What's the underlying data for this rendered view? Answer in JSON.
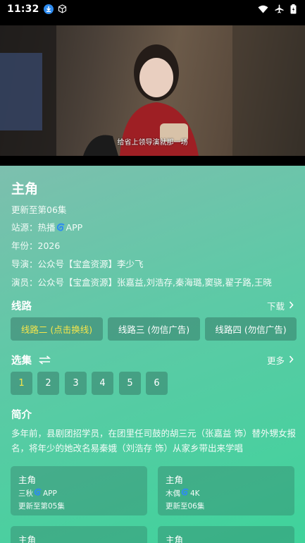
{
  "status_bar": {
    "time": "11:32"
  },
  "video": {
    "subtitle": "给省上领导演就那一场"
  },
  "detail": {
    "title": "主角",
    "update_status": "更新至第06集",
    "site_label": "站源：",
    "site_name": "热播",
    "site_suffix": "APP",
    "year": "年份：2026",
    "director": "导演：公众号【宝盒资源】李少飞",
    "cast": "演员：公众号【宝盒资源】张嘉益,刘浩存,秦海璐,窦骁,翟子路,王晓"
  },
  "lines": {
    "title": "线路",
    "download_label": "下载",
    "buttons": [
      "线路二 (点击换线)",
      "线路三 (勿信广告)",
      "线路四 (勿信广告)"
    ]
  },
  "episodes": {
    "title": "选集",
    "more_label": "更多",
    "items": [
      "1",
      "2",
      "3",
      "4",
      "5",
      "6"
    ]
  },
  "intro": {
    "title": "简介",
    "text": "多年前，县剧团招学员，在团里任司鼓的胡三元（张嘉益 饰）替外甥女报名，将年少的她改名易秦娥（刘浩存 饰）从家乡带出来学唱"
  },
  "cards": [
    {
      "title": "主角",
      "source": "三秋",
      "source_suffix": "APP",
      "update": "更新至第05集"
    },
    {
      "title": "主角",
      "source": "木偶",
      "source_suffix": "4K",
      "update": "更新至06集"
    },
    {
      "title": "主角"
    },
    {
      "title": "主角"
    }
  ],
  "colors": {
    "accent_yellow": "#f7e64a",
    "logo_blue": "#2f8cf0"
  }
}
